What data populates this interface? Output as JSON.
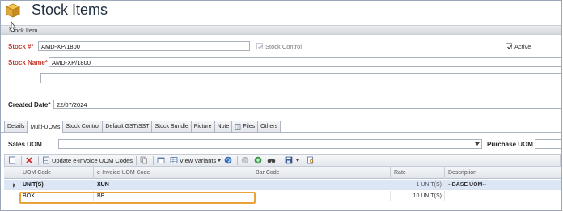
{
  "title": "Stock Items",
  "section": "Stock Item",
  "form": {
    "stock_no_label": "Stock #",
    "stock_no_value": "AMD-XP/1800",
    "stock_control_label": "Stock Control",
    "active_label": "Active",
    "stock_name_label": "Stock Name",
    "stock_name_value": "AMD-XP/1800",
    "created_date_label": "Created Date",
    "created_date_value": "22/07/2024",
    "required_mark": "*"
  },
  "tabs": [
    "Details",
    "Multi-UOMs",
    "Stock Control",
    "Default GST/SST",
    "Stock Bundle",
    "Picture",
    "Note",
    "Files",
    "Others"
  ],
  "uom": {
    "sales_label": "Sales UOM",
    "purchase_label": "Purchase UOM"
  },
  "toolbar": {
    "update_einvoice": "Update e-Invoice UOM Codes",
    "view_variants": "View Variants"
  },
  "grid": {
    "headers": [
      "UOM Code",
      "e-Invoice UOM Code",
      "Bar Code",
      "Rate",
      "Description"
    ],
    "rows": [
      {
        "uom": "UNIT(S)",
        "einv": "XUN",
        "bar": "",
        "rate": "1 UNIT(S)",
        "desc": "--BASE UOM--"
      },
      {
        "uom": "BOX",
        "einv": "BB",
        "bar": "",
        "rate": "10 UNIT(S)",
        "desc": ""
      }
    ]
  },
  "colors": {
    "required": "#c0392b",
    "selected_row": "#dbe6f6",
    "highlight": "#e8a33b"
  }
}
